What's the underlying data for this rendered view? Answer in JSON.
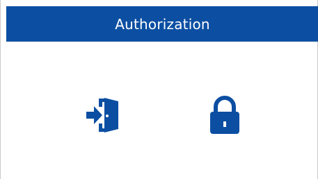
{
  "header": {
    "title": "Authorization"
  },
  "colors": {
    "accent": "#0c4fa2",
    "background": "#ffffff",
    "border": "#c9c9c9"
  },
  "actions": [
    {
      "icon": "login-door-icon"
    },
    {
      "icon": "lock-icon"
    }
  ]
}
